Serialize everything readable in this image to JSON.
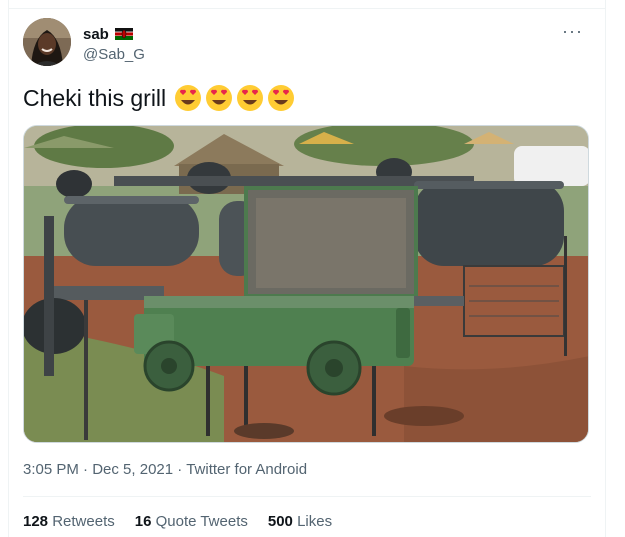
{
  "tweet": {
    "display_name": "sab",
    "handle": "@Sab_G",
    "more_label": "···",
    "text": "Cheki this grill",
    "emojis": [
      "heart-eyes",
      "heart-eyes",
      "heart-eyes",
      "heart-eyes"
    ],
    "time": "3:05 PM",
    "sep1": "·",
    "date": "Dec 5, 2021",
    "sep2": "·",
    "source": "Twitter for Android"
  },
  "stats": {
    "retweets_count": "128",
    "retweets_label": "Retweets",
    "quotes_count": "16",
    "quotes_label": "Quote Tweets",
    "likes_count": "500",
    "likes_label": "Likes"
  },
  "colors": {
    "text_primary": "#0f1419",
    "text_secondary": "#536471",
    "border": "#eff3f4",
    "car_green": "#4f8050",
    "drum_grey": "#474e52",
    "soil": "#9a5a3e"
  }
}
